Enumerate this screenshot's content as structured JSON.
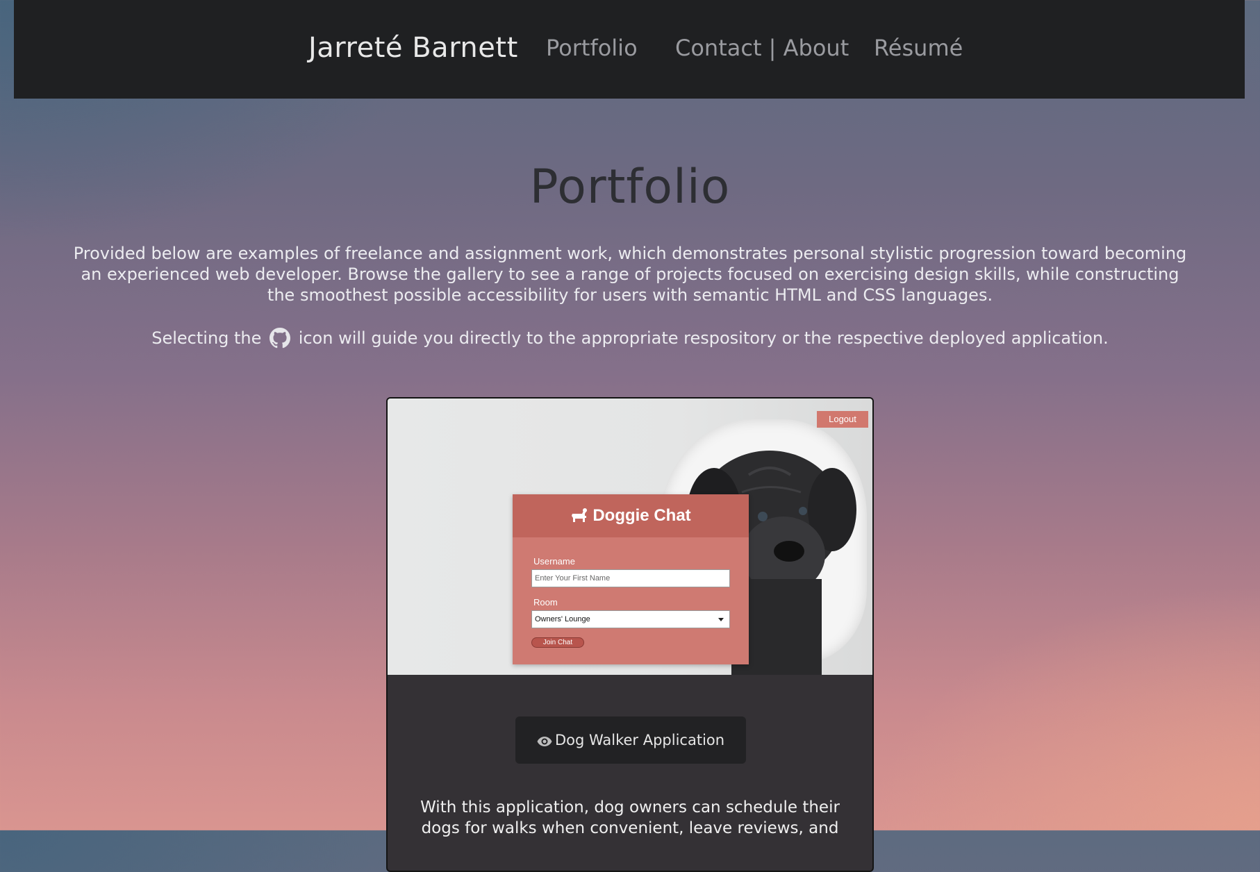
{
  "nav": {
    "brand": "Jarreté Barnett",
    "links": [
      "Portfolio",
      "Contact | About",
      "Résumé"
    ]
  },
  "main": {
    "title": "Portfolio",
    "intro": "Provided below are examples of freelance and assignment work, which demonstrates personal stylistic progression toward becoming an experienced web developer. Browse the gallery to see a range of projects focused on exercising design skills, while constructing the smoothest possible accessibility for users with semantic HTML and CSS languages.",
    "hint_before": "Selecting the",
    "hint_after": "icon will guide you directly to the appropriate respository or the respective deployed application."
  },
  "project": {
    "preview": {
      "logout": "Logout",
      "app_title": "Doggie Chat",
      "username_label": "Username",
      "username_placeholder": "Enter Your First Name",
      "room_label": "Room",
      "room_value": "Owners' Lounge",
      "join_label": "Join Chat"
    },
    "button_label": "Dog Walker Application",
    "description": "With this application, dog owners can schedule their dogs for walks when convenient, leave reviews, and"
  },
  "colors": {
    "navbar": "#1f2022",
    "chat_panel": "#cf7a72",
    "chat_header": "#c0655c",
    "card": "#343135"
  },
  "icons": {
    "github": "github-icon",
    "eye": "eye-icon",
    "dog": "dog-icon"
  }
}
